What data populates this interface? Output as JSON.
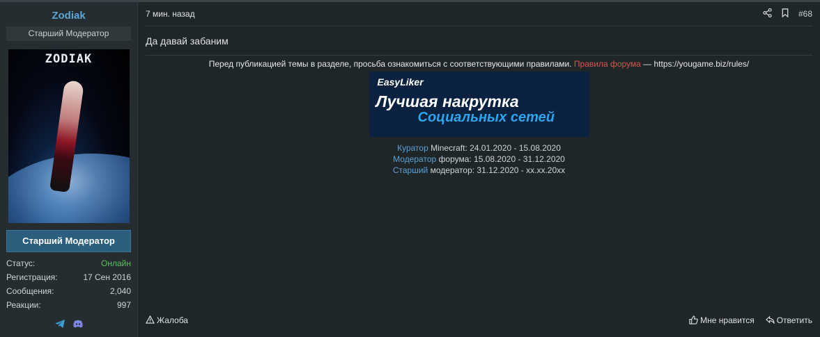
{
  "user": {
    "name": "Zodiak",
    "title": "Старший Модератор",
    "avatar_logo": "ZODIAK",
    "banner": "Старший Модератор"
  },
  "stats": [
    {
      "key": "Статус:",
      "value": "Онлайн"
    },
    {
      "key": "Регистрация:",
      "value": "17 Сен 2016"
    },
    {
      "key": "Сообщения:",
      "value": "2,040"
    },
    {
      "key": "Реакции:",
      "value": "997"
    }
  ],
  "contacts": [
    "telegram-icon",
    "discord-icon"
  ],
  "post": {
    "time": "7 мин. назад",
    "number": "#68",
    "message": "Да давай забаним"
  },
  "signature": {
    "rules_prefix": "Перед публикацией темы в разделе, просьба ознакомиться с соответствующими правилами.",
    "rules_link": "Правила форума",
    "rules_suffix": "— https://yougame.biz/rules/",
    "ad_brand": "EasyLiker",
    "ad_line1": "Лучшая накрутка",
    "ad_line2": "Социальных сетей",
    "roles": [
      {
        "hl": "Куратор",
        "rest": "Minecraft: 24.01.2020 - 15.08.2020"
      },
      {
        "hl": "Модератор",
        "rest": "форума: 15.08.2020 - 31.12.2020"
      },
      {
        "hl": "Старший",
        "rest": "модератор: 31.12.2020 - xx.xx.20xx"
      }
    ]
  },
  "footer": {
    "report": "Жалоба",
    "like": "Мне нравится",
    "reply": "Ответить"
  },
  "colors": {
    "accent": "#5ba7d6",
    "online": "#5fbf5f",
    "link_red": "#d9534f"
  }
}
